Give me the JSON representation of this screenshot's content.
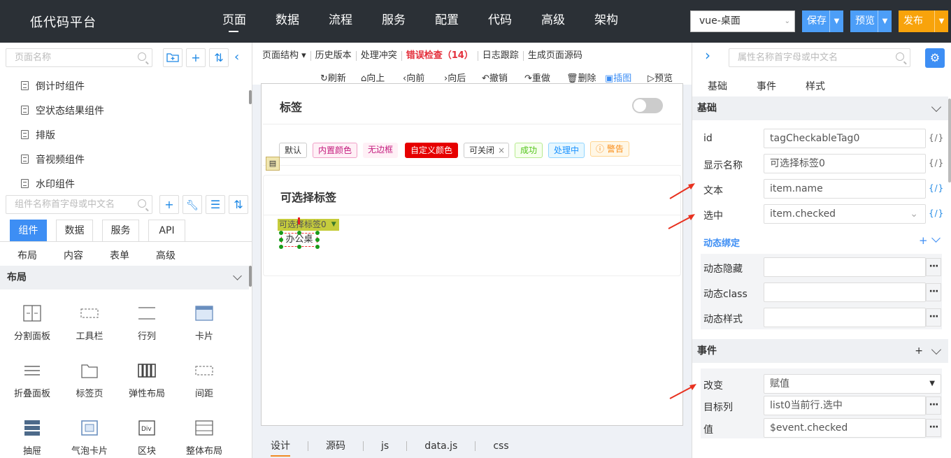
{
  "header": {
    "brand": "低代码平台",
    "nav": [
      "页面",
      "数据",
      "流程",
      "服务",
      "配置",
      "代码",
      "高级",
      "架构"
    ],
    "env": "vue-桌面",
    "save": "保存",
    "preview": "预览",
    "publish": "发布"
  },
  "left": {
    "page_search_placeholder": "页面名称",
    "pages": [
      "倒计时组件",
      "空状态结果组件",
      "排版",
      "音视频组件",
      "水印组件"
    ],
    "comp_search_placeholder": "组件名称首字母或中文名",
    "tabs": [
      "组件",
      "数据",
      "服务",
      "API"
    ],
    "subtabs": [
      "布局",
      "内容",
      "表单",
      "高级"
    ],
    "section": "布局",
    "components": [
      "分割面板",
      "工具栏",
      "行列",
      "卡片",
      "折叠面板",
      "标签页",
      "弹性布局",
      "间距",
      "抽屉",
      "气泡卡片",
      "区块",
      "整体布局"
    ]
  },
  "center": {
    "toolbar": [
      "页面结构 ▾",
      "历史版本",
      "处理冲突",
      "错误检查（14）",
      "日志跟踪",
      "生成页面源码"
    ],
    "actions": [
      "刷新",
      "向上",
      "向前",
      "向后",
      "撤销",
      "重做",
      "删除",
      "插图",
      "预览"
    ],
    "card1_title": "标签",
    "tags": [
      "默认",
      "内置颜色",
      "无边框",
      "自定义颜色",
      "可关闭",
      "成功",
      "处理中",
      "警告"
    ],
    "card2_title": "可选择标签",
    "selected_label": "可选择标签0",
    "selected_text": "办公桌",
    "bottom_tabs": [
      "设计",
      "源码",
      "js",
      "data.js",
      "css"
    ]
  },
  "right": {
    "search_placeholder": "属性名称首字母或中文名",
    "tabs": [
      "基础",
      "事件",
      "样式"
    ],
    "section_basic": "基础",
    "fields": [
      {
        "label": "id",
        "value": "tagCheckableTag0"
      },
      {
        "label": "显示名称",
        "value": "可选择标签0"
      },
      {
        "label": "文本",
        "value": "item.name"
      },
      {
        "label": "选中",
        "value": "item.checked"
      }
    ],
    "dynamic_title": "动态绑定",
    "dynamic": [
      "动态隐藏",
      "动态class",
      "动态样式"
    ],
    "section_event": "事件",
    "event_fields": [
      {
        "label": "改变",
        "value": "赋值"
      },
      {
        "label": "目标列",
        "value": "list0当前行.选中"
      },
      {
        "label": "值",
        "value": "$event.checked"
      }
    ],
    "fx": "{/}"
  },
  "colors": {
    "primary": "#3d8ef4",
    "orange": "#f8a30b",
    "topbar": "#2b3036",
    "error": "#e4303c",
    "arrow": "#e8311f"
  }
}
